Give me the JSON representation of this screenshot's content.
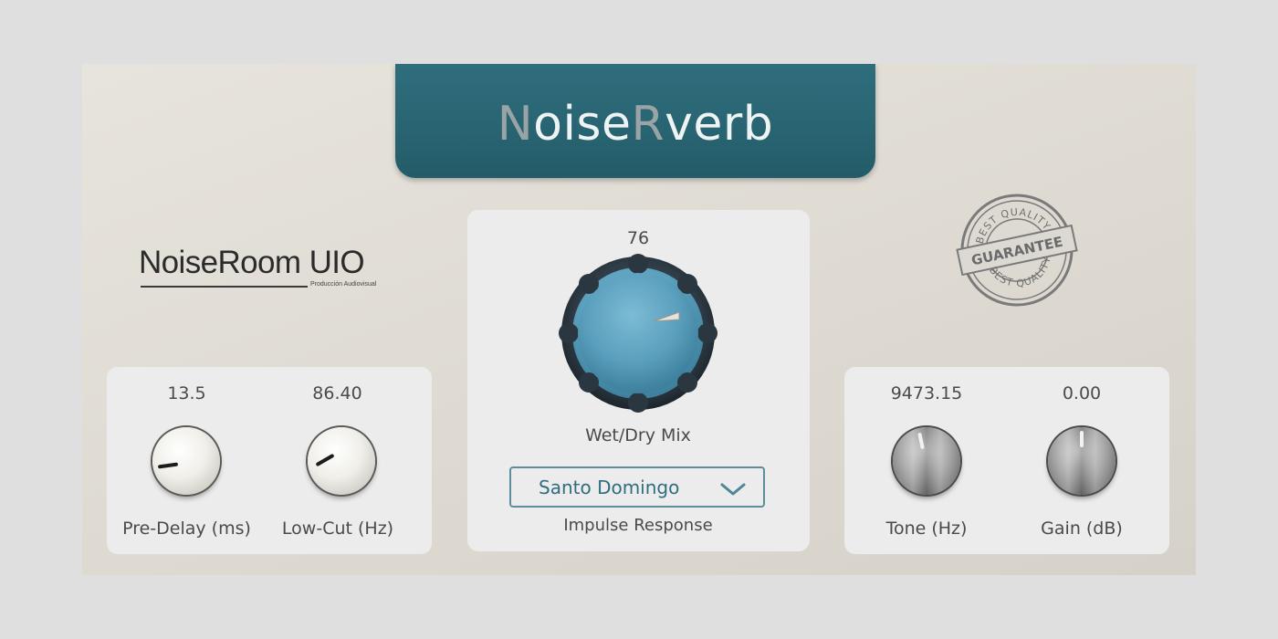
{
  "app": {
    "title_parts": [
      {
        "text": "N",
        "style": "cap"
      },
      {
        "text": "oise",
        "style": "plain"
      },
      {
        "text": "R",
        "style": "cap"
      },
      {
        "text": "verb",
        "style": "plain"
      }
    ]
  },
  "brand": {
    "name": "NoiseRoom UIO",
    "subtitle": "Producción Audiovisual"
  },
  "stamp": {
    "top_text": "BEST QUALITY",
    "center_text": "GUARANTEE",
    "bottom_text": "BEST QUALITY"
  },
  "controls": {
    "pre_delay": {
      "value": "13.5",
      "label": "Pre-Delay (ms)"
    },
    "low_cut": {
      "value": "86.40",
      "label": "Low-Cut (Hz)"
    },
    "wet_dry": {
      "value": "76",
      "label": "Wet/Dry Mix"
    },
    "tone": {
      "value": "9473.15",
      "label": "Tone (Hz)"
    },
    "gain": {
      "value": "0.00",
      "label": "Gain (dB)"
    }
  },
  "impulse_response": {
    "selected": "Santo Domingo",
    "label": "Impulse Response",
    "icon": "chevron-down-icon"
  },
  "colors": {
    "header": "#2a6674",
    "big_knob": "#5a9fbd",
    "dropdown_text": "#2f6e80",
    "background": "#dfdfdf"
  }
}
